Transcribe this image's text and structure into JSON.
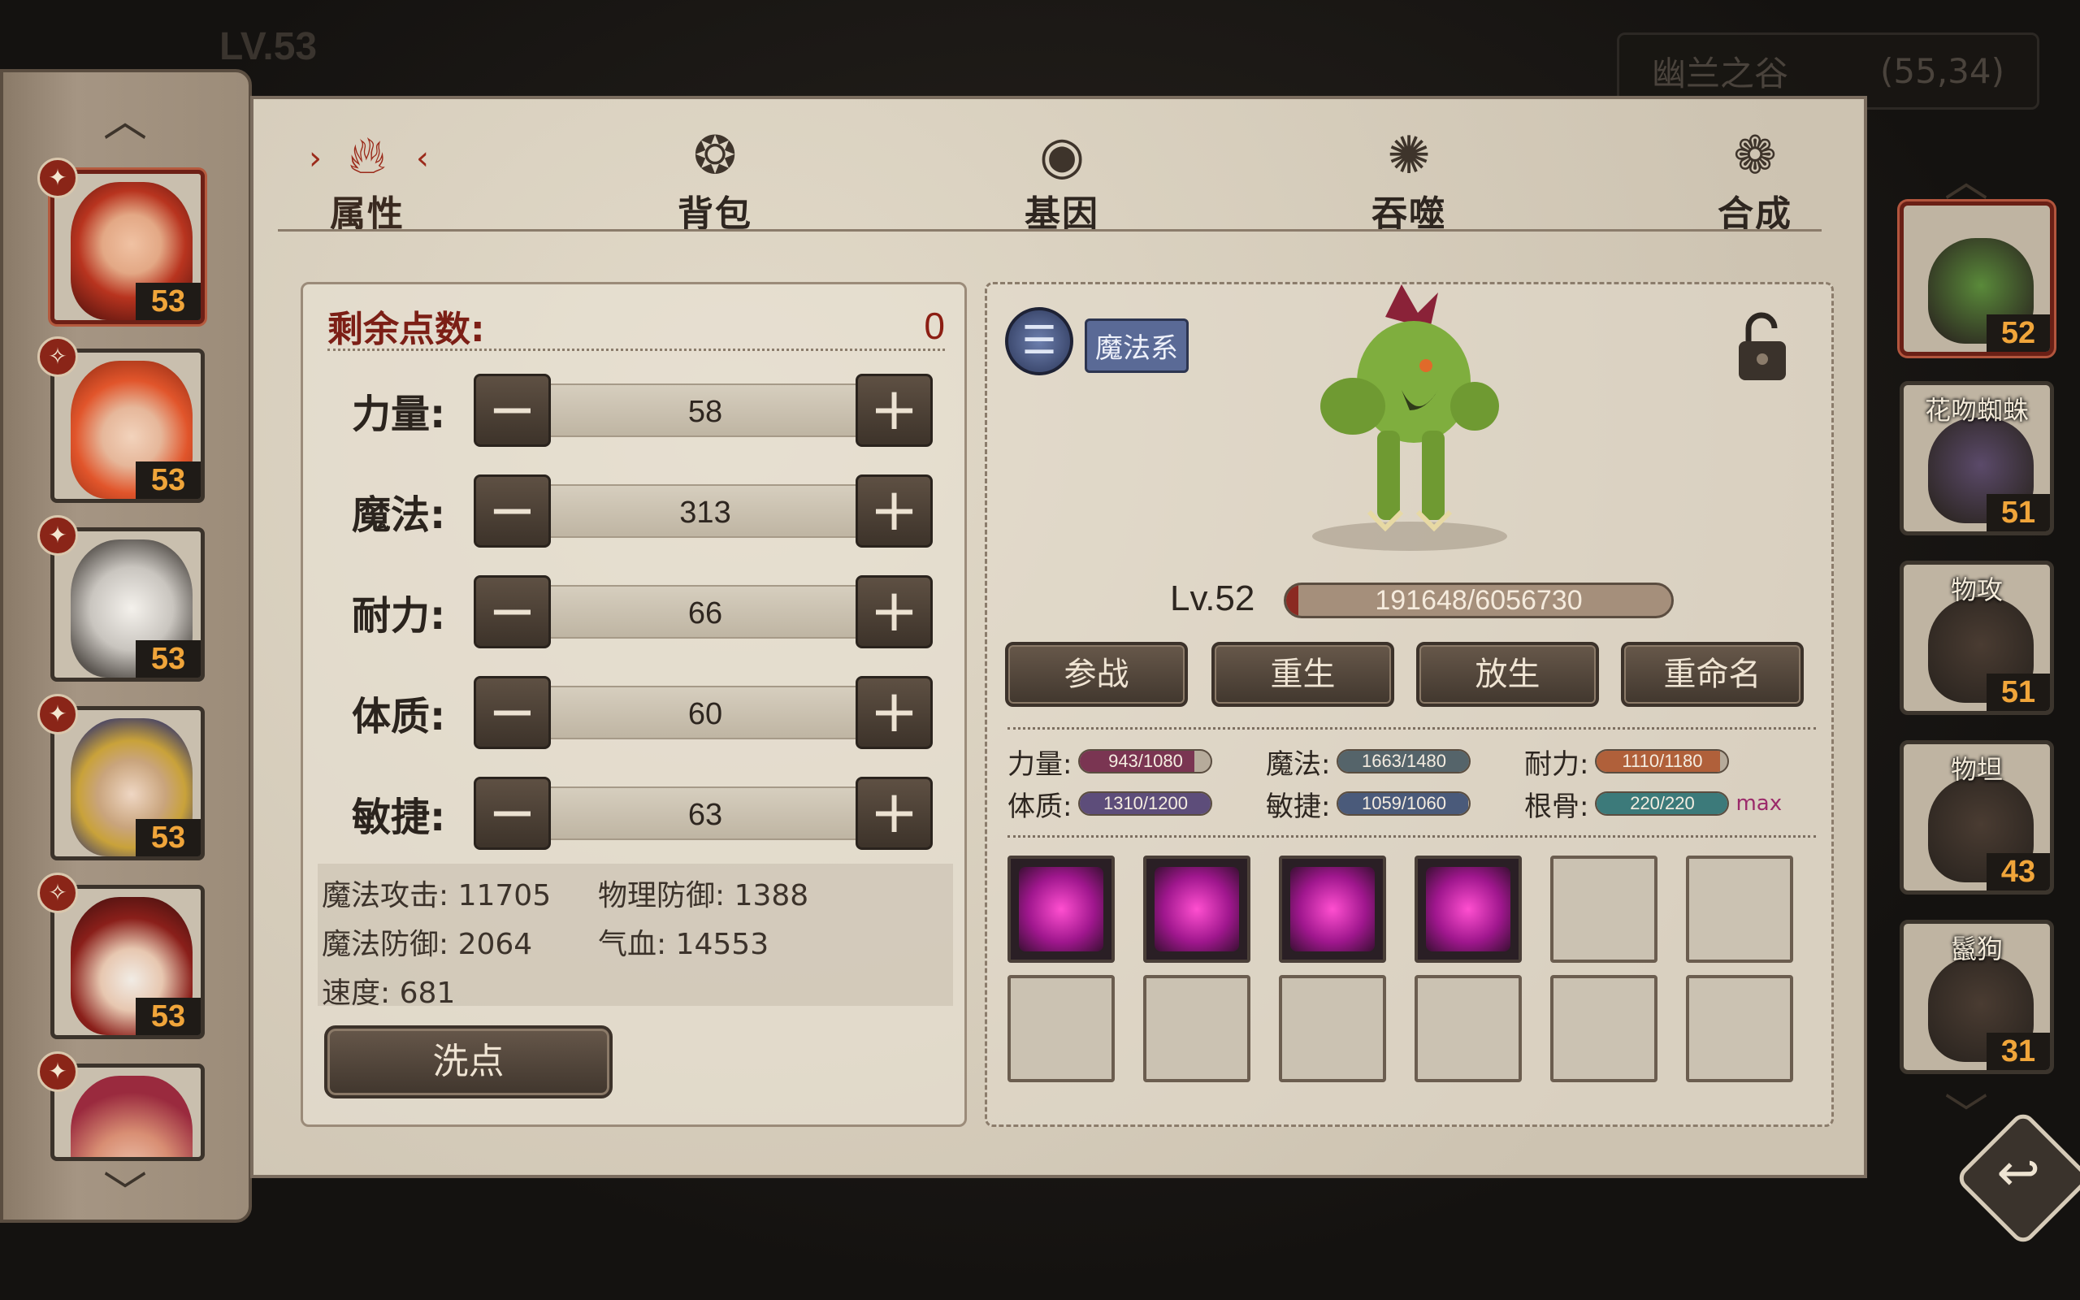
{
  "hud": {
    "level": "LV.53",
    "map_name": "幽兰之谷",
    "coords": "(55,34)"
  },
  "tabs": [
    {
      "label": "属性",
      "icon": "flame-icon"
    },
    {
      "label": "背包",
      "icon": "bag-icon"
    },
    {
      "label": "基因",
      "icon": "eye-icon"
    },
    {
      "label": "吞噬",
      "icon": "devour-icon"
    },
    {
      "label": "合成",
      "icon": "swirl-icon"
    }
  ],
  "heroes": [
    {
      "level": "53",
      "badge": "✦"
    },
    {
      "level": "53",
      "badge": "✧"
    },
    {
      "level": "53",
      "badge": "✦"
    },
    {
      "level": "53",
      "badge": "✦"
    },
    {
      "level": "53",
      "badge": "✧"
    },
    {
      "level": "",
      "badge": "✦"
    }
  ],
  "stats": {
    "remain_label": "剩余点数:",
    "remain_value": "0",
    "attributes": [
      {
        "label": "力量:",
        "value": "58"
      },
      {
        "label": "魔法:",
        "value": "313"
      },
      {
        "label": "耐力:",
        "value": "66"
      },
      {
        "label": "体质:",
        "value": "60"
      },
      {
        "label": "敏捷:",
        "value": "63"
      }
    ],
    "derived": {
      "magic_attack": "魔法攻击: 11705",
      "phys_defense": "物理防御: 1388",
      "magic_defense": "魔法防御: 2064",
      "hp": "气血: 14553",
      "speed": "速度: 681"
    },
    "reset_label": "洗点"
  },
  "pet": {
    "type": "魔法系",
    "level": "Lv.52",
    "exp": "191648/6056730",
    "exp_fraction": 0.032,
    "buttons": [
      "参战",
      "重生",
      "放生",
      "重命名"
    ],
    "aptitudes": [
      {
        "label": "力量:",
        "value": "943/1080",
        "fraction": 0.87,
        "color": "#7a3552"
      },
      {
        "label": "魔法:",
        "value": "1663/1480",
        "fraction": 1.0,
        "color": "#55646a"
      },
      {
        "label": "耐力:",
        "value": "1110/1180",
        "fraction": 0.94,
        "color": "#b0603a"
      },
      {
        "label": "体质:",
        "value": "1310/1200",
        "fraction": 1.0,
        "color": "#5d4d7a"
      },
      {
        "label": "敏捷:",
        "value": "1059/1060",
        "fraction": 0.99,
        "color": "#4a5a7a"
      },
      {
        "label": "根骨:",
        "value": "220/220",
        "fraction": 1.0,
        "color": "#3c7a7a",
        "max": "max"
      }
    ],
    "skills_filled": 4,
    "skill_slots": 12
  },
  "pet_list": [
    {
      "name": "",
      "level": "52",
      "color": "#5a8a3a"
    },
    {
      "name": "花吻蜘蛛",
      "level": "51",
      "color": "#5b4a6a"
    },
    {
      "name": "物攻",
      "level": "51",
      "color": "#4a3c32"
    },
    {
      "name": "物坦",
      "level": "43",
      "color": "#4a3c32"
    },
    {
      "name": "鬣狗",
      "level": "31",
      "color": "#4a3c32"
    }
  ]
}
